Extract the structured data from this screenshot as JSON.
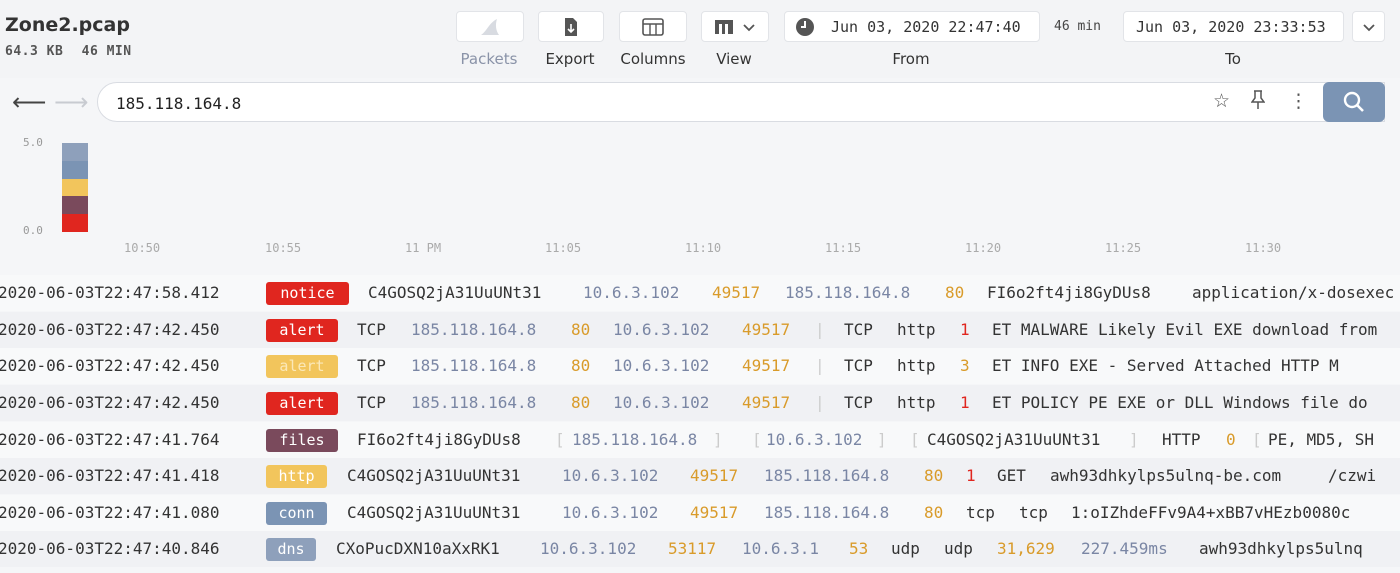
{
  "file": {
    "name": "Zone2.pcap",
    "size": "64.3 KB",
    "duration": "46 MIN"
  },
  "toolbar": {
    "packets": "Packets",
    "export": "Export",
    "columns": "Columns",
    "view": "View",
    "from_label": "From",
    "to_label": "To",
    "from_value": "Jun 03, 2020 22:47:40",
    "to_value": "Jun 03, 2020 23:33:53",
    "span": "46 min"
  },
  "search": {
    "query": "185.118.164.8"
  },
  "histogram": {
    "y_ticks": [
      "5.0",
      "0.0"
    ],
    "x_ticks": [
      "10:50",
      "10:55",
      "11 PM",
      "11:05",
      "11:10",
      "11:15",
      "11:20",
      "11:25",
      "11:30"
    ],
    "bar_segments": [
      {
        "color": "#e0261f",
        "value": 1
      },
      {
        "color": "#7a4a5c",
        "value": 1
      },
      {
        "color": "#f2c55c",
        "value": 1
      },
      {
        "color": "#7b94b4",
        "value": 1
      },
      {
        "color": "#8ea0bb",
        "value": 1
      }
    ]
  },
  "rows": [
    {
      "ts": "2020-06-03T22:47:58.412",
      "tag": "notice",
      "tag_color": "#e0261f",
      "f1": "C4GOSQ2jA31UuUNt31",
      "f2": "10.6.3.102",
      "f3": "49517",
      "f4": "185.118.164.8",
      "f5": "80",
      "f6": "FI6o2ft4ji8GyDUs8",
      "f7": "application/x-dosexec"
    },
    {
      "ts": "2020-06-03T22:47:42.450",
      "tag": "alert",
      "tag_color": "#e0261f",
      "f1": "TCP",
      "f2": "185.118.164.8",
      "f3": "80",
      "f4": "10.6.3.102",
      "f5": "49517",
      "f6": "TCP",
      "f7": "http",
      "f8": "1",
      "f9": "ET MALWARE Likely Evil EXE download from"
    },
    {
      "ts": "2020-06-03T22:47:42.450",
      "tag": "alert",
      "tag_color": "#f2c55c",
      "f1": "TCP",
      "f2": "185.118.164.8",
      "f3": "80",
      "f4": "10.6.3.102",
      "f5": "49517",
      "f6": "TCP",
      "f7": "http",
      "f8": "3",
      "f9": "ET INFO EXE - Served Attached HTTP  M"
    },
    {
      "ts": "2020-06-03T22:47:42.450",
      "tag": "alert",
      "tag_color": "#e0261f",
      "f1": "TCP",
      "f2": "185.118.164.8",
      "f3": "80",
      "f4": "10.6.3.102",
      "f5": "49517",
      "f6": "TCP",
      "f7": "http",
      "f8": "1",
      "f9": "ET POLICY PE EXE or DLL Windows file do"
    },
    {
      "ts": "2020-06-03T22:47:41.764",
      "tag": "files",
      "tag_color": "#7a4a5c",
      "f1": "FI6o2ft4ji8GyDUs8",
      "f2": "185.118.164.8",
      "f3": "10.6.3.102",
      "f4": "C4GOSQ2jA31UuUNt31",
      "f5": "HTTP",
      "f6": "0",
      "f7": "PE, MD5, SH"
    },
    {
      "ts": "2020-06-03T22:47:41.418",
      "tag": "http",
      "tag_color": "#f2c55c",
      "f1": "C4GOSQ2jA31UuUNt31",
      "f2": "10.6.3.102",
      "f3": "49517",
      "f4": "185.118.164.8",
      "f5": "80",
      "f6": "1",
      "f7": "GET",
      "f8": "awh93dhkylps5ulnq-be.com",
      "f9": "/czwi"
    },
    {
      "ts": "2020-06-03T22:47:41.080",
      "tag": "conn",
      "tag_color": "#7b94b4",
      "f1": "C4GOSQ2jA31UuUNt31",
      "f2": "10.6.3.102",
      "f3": "49517",
      "f4": "185.118.164.8",
      "f5": "80",
      "f6": "tcp",
      "f7": "tcp",
      "f8": "1:oIZhdeFFv9A4+xBB7vHEzb0080c"
    },
    {
      "ts": "2020-06-03T22:47:40.846",
      "tag": "dns",
      "tag_color": "#8ea0bb",
      "f1": "CXoPucDXN10aXxRK1",
      "f2": "10.6.3.102",
      "f3": "53117",
      "f4": "10.6.3.1",
      "f5": "53",
      "f6": "udp",
      "f7": "udp",
      "f8": "31,629",
      "f9": "227.459ms",
      "f10": "awh93dhkylps5ulnq"
    }
  ]
}
